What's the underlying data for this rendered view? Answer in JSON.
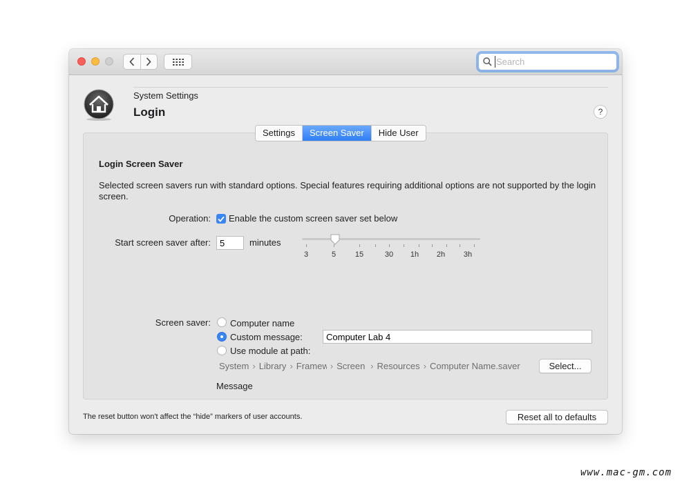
{
  "window": {
    "search_placeholder": "Search"
  },
  "header": {
    "subtitle": "System Settings",
    "title": "Login",
    "help": "?"
  },
  "tabs": [
    {
      "label": "Settings",
      "active": false
    },
    {
      "label": "Screen Saver",
      "active": true
    },
    {
      "label": "Hide User",
      "active": false
    }
  ],
  "section": {
    "title": "Login Screen Saver",
    "description": "Selected screen savers run with standard options. Special features requiring additional options are not supported by the login screen."
  },
  "operation": {
    "label": "Operation:",
    "checkbox_label": "Enable the custom screen saver set below",
    "checked": true
  },
  "start_after": {
    "label": "Start screen saver after:",
    "value": "5",
    "unit": "minutes",
    "slider_ticks": [
      "3",
      "5",
      "15",
      "30",
      "1h",
      "2h",
      "3h"
    ],
    "slider_value": "5"
  },
  "screen_saver": {
    "label": "Screen saver:",
    "options": [
      {
        "label": "Computer name",
        "selected": false
      },
      {
        "label": "Custom message:",
        "selected": true
      },
      {
        "label": "Use module at path:",
        "selected": false
      }
    ],
    "custom_message": "Computer Lab 4",
    "path": [
      "System",
      "Library",
      "Framew",
      "Screen",
      "Resources",
      "Computer Name.saver"
    ],
    "select_button": "Select...",
    "message_caption": "Message"
  },
  "footer": {
    "note": "The reset button won't affect the “hide” markers of user accounts.",
    "reset_button": "Reset all to defaults"
  },
  "watermark": "www.mac-gm.com",
  "colors": {
    "accent": "#3b86f7",
    "close": "#fc605b",
    "minimize": "#fdbc40"
  }
}
